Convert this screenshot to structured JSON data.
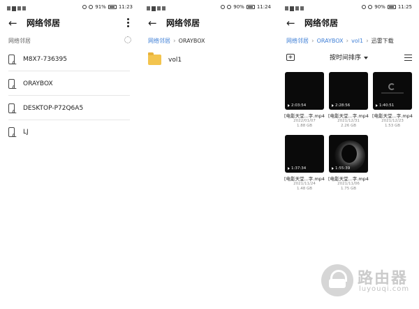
{
  "panel1": {
    "status": {
      "battery": "91%",
      "time": "11:23"
    },
    "title": "网络邻居",
    "section_label": "网络邻居",
    "devices": [
      {
        "label": "M8X7-736395"
      },
      {
        "label": "ORAYBOX"
      },
      {
        "label": "DESKTOP-P72Q6A5"
      },
      {
        "label": "LJ"
      }
    ]
  },
  "panel2": {
    "status": {
      "battery": "90%",
      "time": "11:24"
    },
    "title": "网络邻居",
    "breadcrumb": [
      "网络邻居",
      "ORAYBOX"
    ],
    "folders": [
      {
        "label": "vol1",
        "color": "#f3c44e"
      }
    ]
  },
  "panel3": {
    "status": {
      "battery": "90%",
      "time": "11:25"
    },
    "title": "网络邻居",
    "breadcrumb": [
      "网络邻居",
      "ORAYBOX",
      "vol1",
      "迅雷下载"
    ],
    "sort_label": "按时间排序",
    "videos": [
      {
        "name": "[电影天堂...字.mp4",
        "duration": "2:03:54",
        "date": "2022/01/07",
        "size": "1.88 GB",
        "thumb": "dark"
      },
      {
        "name": "[电影天堂...字.mp4",
        "duration": "2:28:56",
        "date": "2021/12/31",
        "size": "2.26 GB",
        "thumb": "dark"
      },
      {
        "name": "[电影天堂...字.mp4",
        "duration": "1:40:51",
        "date": "2021/12/23",
        "size": "1.53 GB",
        "thumb": "logo"
      },
      {
        "name": "[电影天堂...字.mp4",
        "duration": "1:37:34",
        "date": "2021/11/24",
        "size": "1.48 GB",
        "thumb": "dark"
      },
      {
        "name": "[电影天堂...字.mp4",
        "duration": "1:55:39",
        "date": "2021/11/06",
        "size": "1.75 GB",
        "thumb": "glow"
      }
    ]
  },
  "watermark": {
    "text": "路由器",
    "sub": "luyouqi.com"
  },
  "colors": {
    "link": "#3f7fd6",
    "folder": "#f3c44e",
    "divider": "#e6e6e6"
  }
}
